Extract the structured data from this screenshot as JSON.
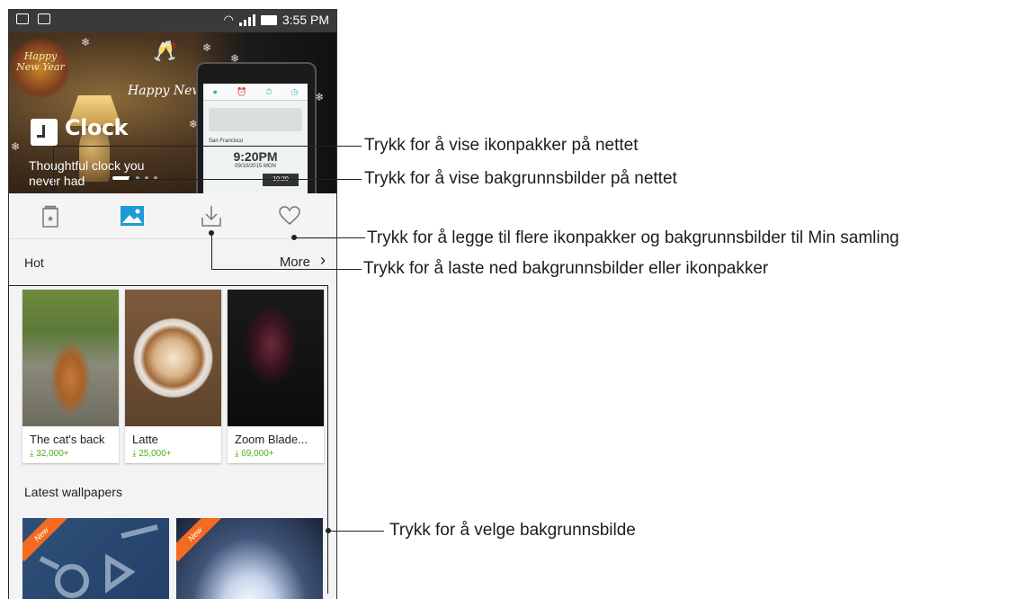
{
  "status_bar": {
    "time": "3:55 PM"
  },
  "banner": {
    "badge_text": "Happy New Year",
    "greeting": "Happy New Year",
    "app_title": "Clock",
    "tagline": "Thoughtful clock you never had",
    "mini_phone": {
      "city": "San Francisco",
      "time": "9:20PM",
      "date": "09/10/2015 MON",
      "pill": "10:20"
    }
  },
  "toolbar": {
    "items": [
      {
        "name": "icon-packs",
        "icon": "icon-pack-icon"
      },
      {
        "name": "wallpapers",
        "icon": "wallpaper-icon",
        "active": true
      },
      {
        "name": "downloads",
        "icon": "download-icon"
      },
      {
        "name": "favorites",
        "icon": "heart-icon"
      }
    ],
    "accent": "#1e9bd7"
  },
  "hot": {
    "label": "Hot",
    "more_label": "More",
    "cards": [
      {
        "title": "The cat's back",
        "downloads": "32,000+"
      },
      {
        "title": "Latte",
        "downloads": "25,000+"
      },
      {
        "title": "Zoom Blade...",
        "downloads": "69,000+"
      }
    ]
  },
  "latest": {
    "label": "Latest wallpapers",
    "badge": "New"
  },
  "callouts": {
    "icon_packs": "Trykk for å vise ikonpakker på nettet",
    "wallpapers": "Trykk for å vise bakgrunnsbilder på nettet",
    "favorites": "Trykk for å legge til flere ikonpakker og bakgrunnsbilder til Min samling",
    "downloads": "Trykk for å laste ned bakgrunnsbilder eller ikonpakker",
    "select_wallpaper": "Trykk for å velge bakgrunnsbilde"
  },
  "colors": {
    "download_green": "#4caf1a",
    "new_badge": "#f26b21",
    "status_bar": "#3a3a3a"
  }
}
